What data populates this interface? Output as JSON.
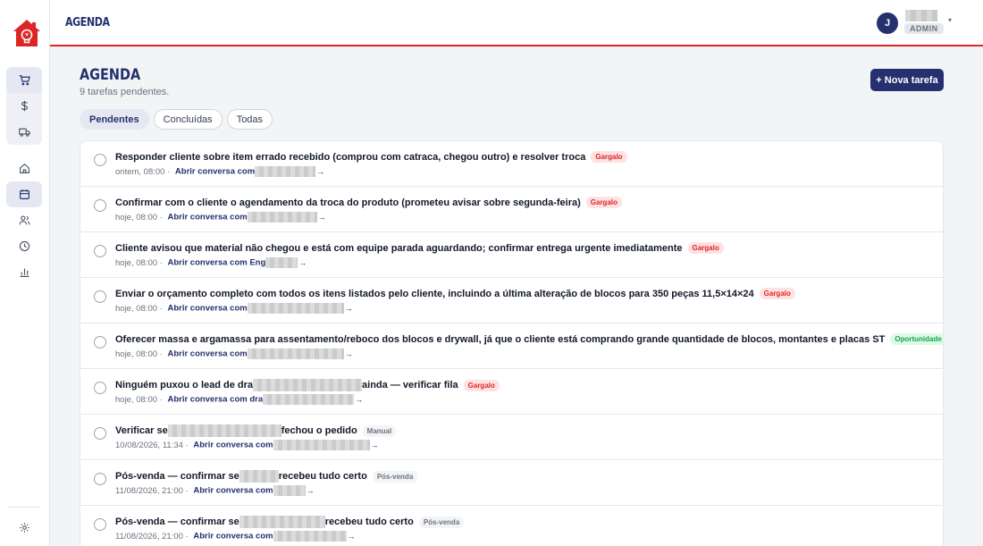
{
  "header": {
    "title": "AGENDA",
    "avatar_initial": "J",
    "role": "ADMIN"
  },
  "page": {
    "title": "AGENDA",
    "subtitle": "9 tarefas pendentes.",
    "new_task_label": "+ Nova tarefa"
  },
  "tabs": [
    {
      "label": "Pendentes",
      "active": true
    },
    {
      "label": "Concluídas",
      "active": false
    },
    {
      "label": "Todas",
      "active": false
    }
  ],
  "tasks": [
    {
      "title": "Responder cliente sobre item errado recebido (comprou com catraca, chegou outro) e resolver troca",
      "tag": "Gargalo",
      "tag_color": "#dc2626",
      "time": "ontem, 08:00",
      "link": "Abrir conversa com"
    },
    {
      "title": "Confirmar com o cliente o agendamento da troca do produto (prometeu avisar sobre segunda-feira)",
      "tag": "Gargalo",
      "tag_color": "#dc2626",
      "time": "hoje, 08:00",
      "link": "Abrir conversa com"
    },
    {
      "title": "Cliente avisou que material não chegou e está com equipe parada aguardando; confirmar entrega urgente imediatamente",
      "tag": "Gargalo",
      "tag_color": "#dc2626",
      "time": "hoje, 08:00",
      "link": "Abrir conversa com Eng"
    },
    {
      "title": "Enviar o orçamento completo com todos os itens listados pelo cliente, incluindo a última alteração de blocos para 350 peças 11,5×14×24",
      "tag": "Gargalo",
      "tag_color": "#dc2626",
      "time": "hoje, 08:00",
      "link": "Abrir conversa com"
    },
    {
      "title": "Oferecer massa e argamassa para assentamento/reboco dos blocos e drywall, já que o cliente está comprando grande quantidade de blocos, montantes e placas ST",
      "tag": "Oportunidade",
      "tag_color": "#16a34a",
      "time": "hoje, 08:00",
      "link": "Abrir conversa com"
    },
    {
      "title_before": "Ninguém puxou o lead de dra",
      "title_after": "ainda — verificar fila",
      "tag": "Gargalo",
      "tag_color": "#dc2626",
      "time": "hoje, 08:00",
      "link": "Abrir conversa com dra"
    },
    {
      "title_before": "Verificar se",
      "title_after": "fechou o pedido",
      "tag": "Manual",
      "tag_color": "#6b7280",
      "time": "10/08/2026, 11:34",
      "link": "Abrir conversa com"
    },
    {
      "title_before": "Pós-venda — confirmar se",
      "title_after": "recebeu tudo certo",
      "tag": "Pós-venda",
      "tag_color": "#6b7280",
      "time": "11/08/2026, 21:00",
      "link": "Abrir conversa com"
    },
    {
      "title_before": "Pós-venda — confirmar se",
      "title_after": "recebeu tudo certo",
      "tag": "Pós-venda",
      "tag_color": "#6b7280",
      "time": "11/08/2026, 21:00",
      "link": "Abrir conversa com"
    }
  ],
  "separator": " · ",
  "arrow": "→",
  "user_caret": "▾",
  "icons": {
    "logo": "house-bulb-logo",
    "cart": "cart-icon",
    "dollar": "dollar-icon",
    "truck": "truck-icon",
    "home": "home-icon",
    "calendar": "calendar-icon",
    "users": "users-icon",
    "clock": "clock-icon",
    "chart": "bar-chart-icon",
    "settings": "gear-icon"
  },
  "colors": {
    "brand": "#25306e",
    "accent": "#dc2626",
    "success": "#16a34a"
  }
}
